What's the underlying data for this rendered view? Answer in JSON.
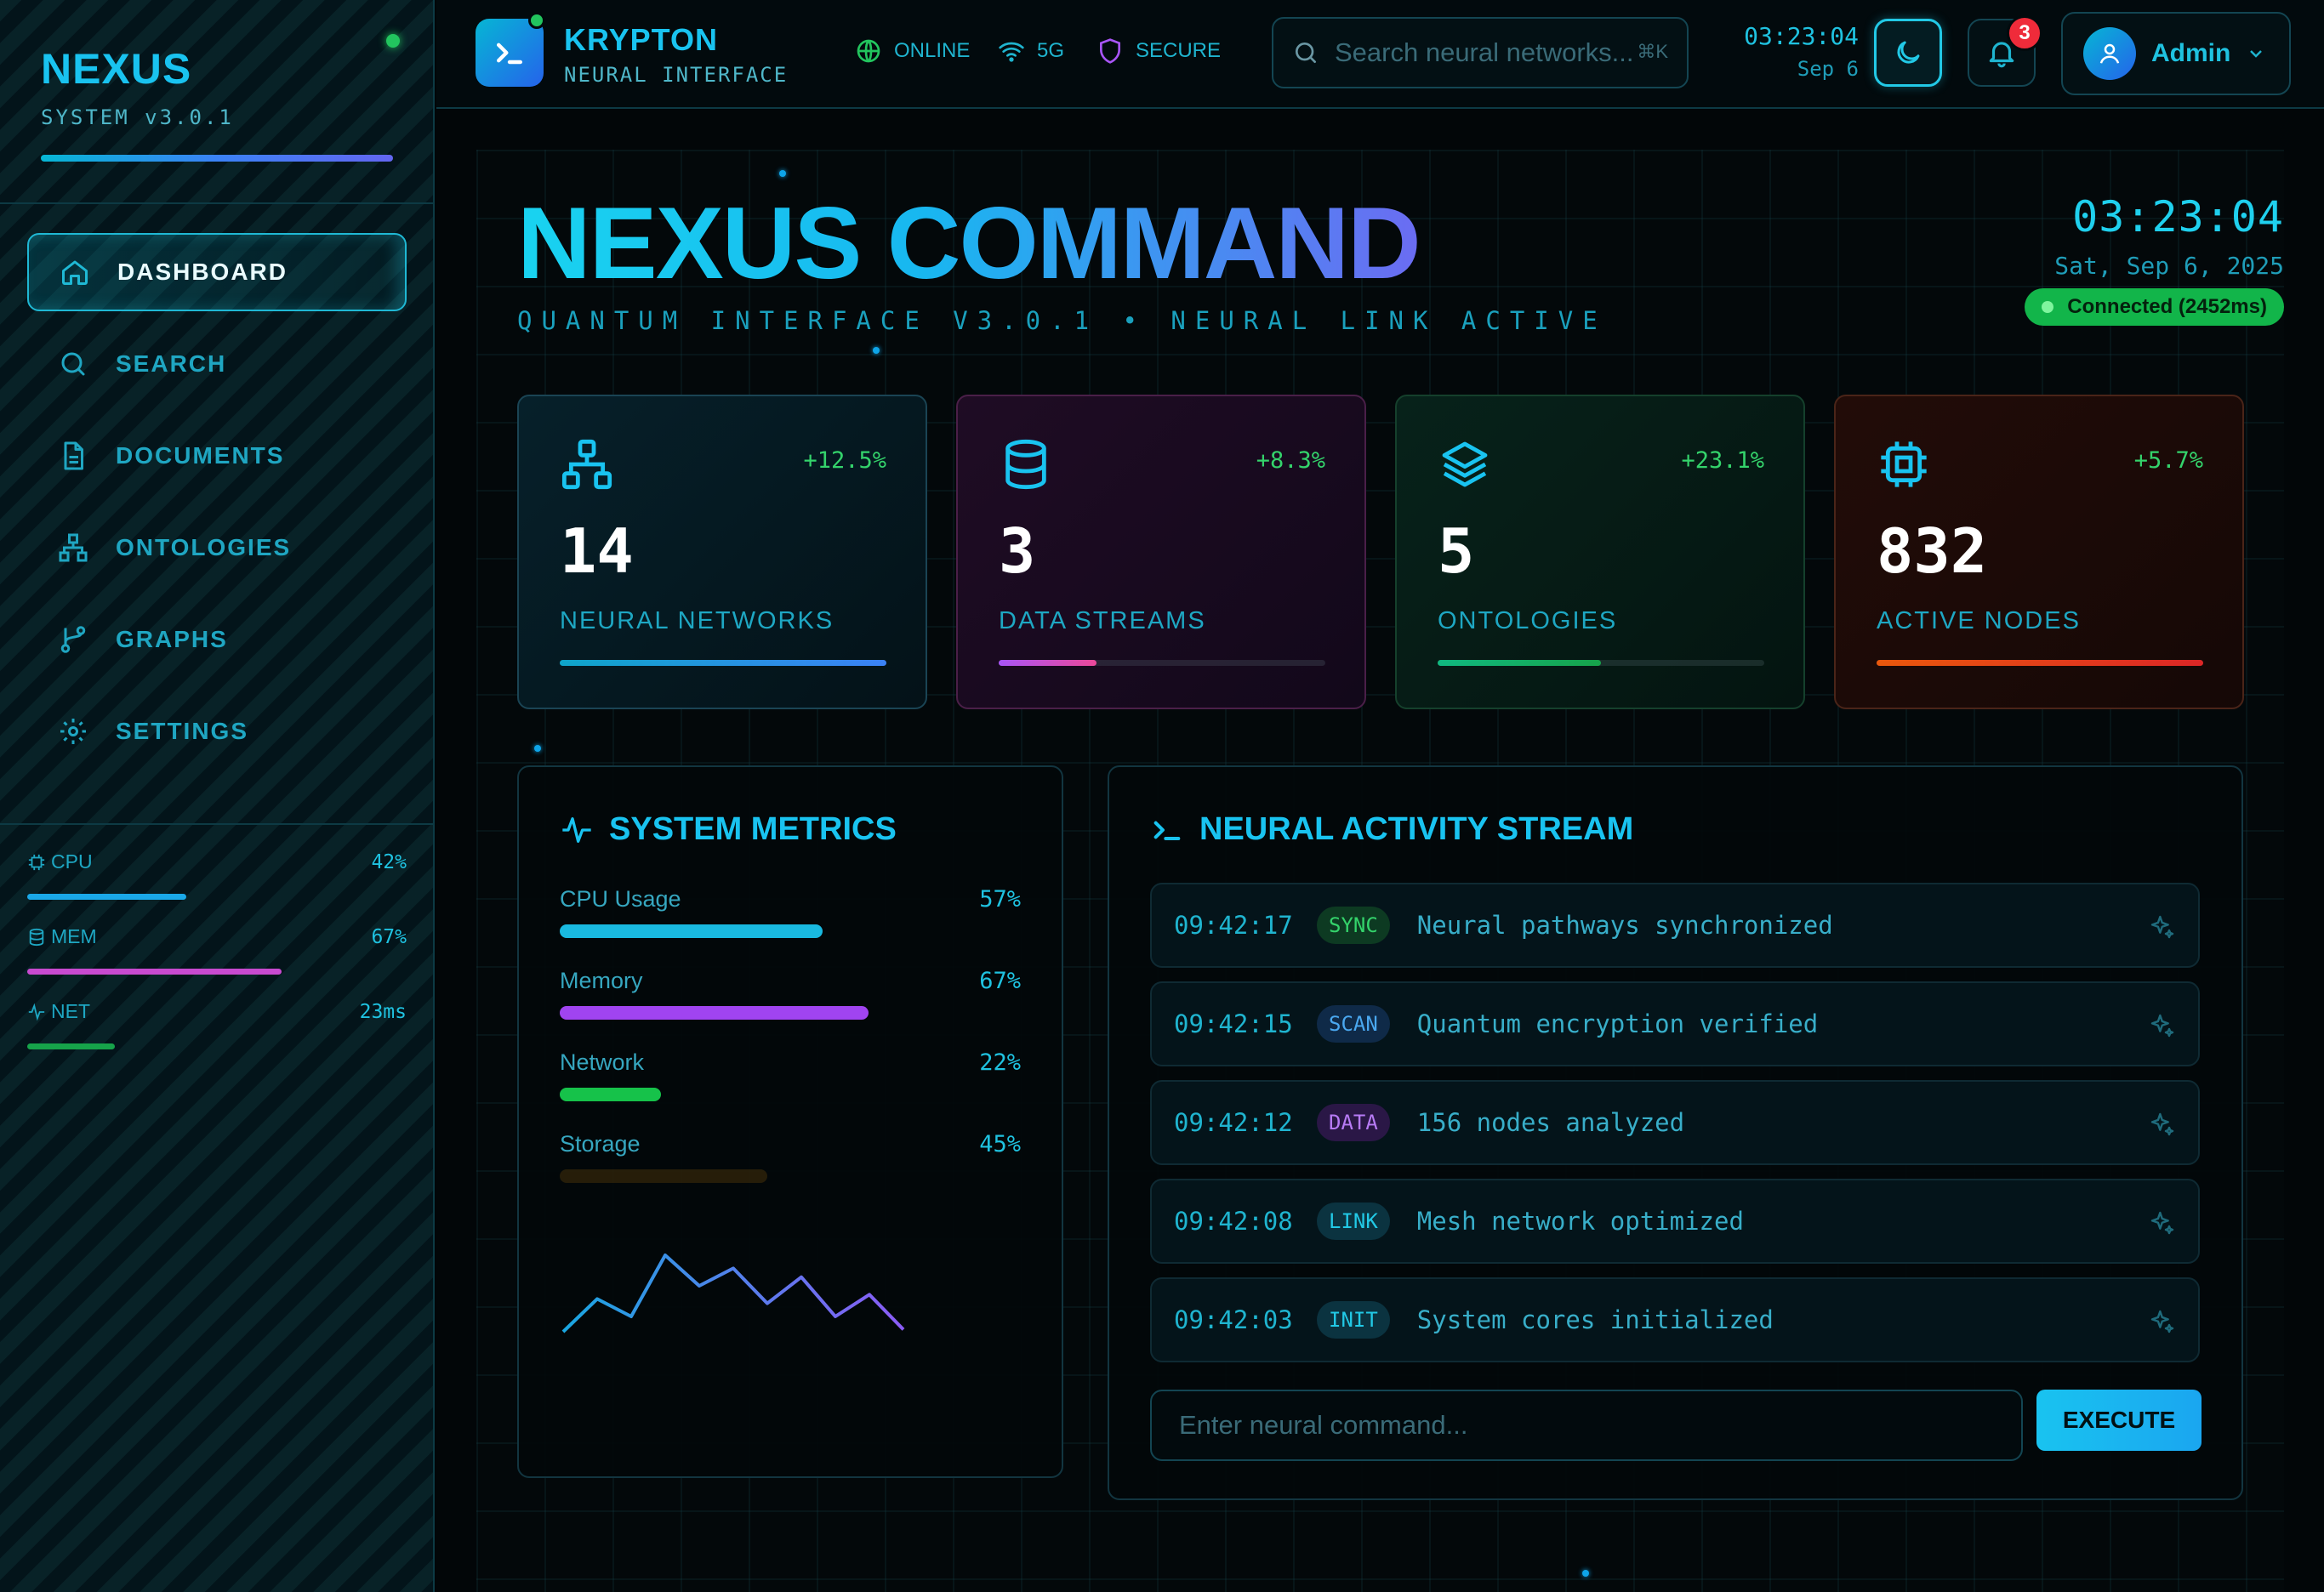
{
  "sidebar": {
    "brand": "NEXUS",
    "version": "SYSTEM v3.0.1",
    "nav": [
      {
        "label": "DASHBOARD",
        "icon": "home-icon"
      },
      {
        "label": "SEARCH",
        "icon": "search-icon"
      },
      {
        "label": "DOCUMENTS",
        "icon": "document-icon"
      },
      {
        "label": "ONTOLOGIES",
        "icon": "hierarchy-icon"
      },
      {
        "label": "GRAPHS",
        "icon": "branch-icon"
      },
      {
        "label": "SETTINGS",
        "icon": "gear-icon"
      }
    ],
    "stats": [
      {
        "label": "CPU",
        "value": "42%",
        "level": 0.42,
        "color": "#1aa8e8",
        "icon": "chip-icon"
      },
      {
        "label": "MEM",
        "value": "67%",
        "level": 0.67,
        "color": "#c84ad0",
        "icon": "database-icon"
      },
      {
        "label": "NET",
        "value": "23ms",
        "level": 0.23,
        "color": "#16a34a",
        "icon": "pulse-icon"
      }
    ]
  },
  "header": {
    "app_name": "KRYPTON",
    "app_sub": "NEURAL INTERFACE",
    "status_online": "ONLINE",
    "status_network": "5G",
    "status_secure": "SECURE",
    "search_placeholder": "Search neural networks...",
    "search_shortcut": "⌘K",
    "time": "03:23:04",
    "date": "Sep 6",
    "notifications": "3",
    "user": "Admin"
  },
  "hero": {
    "title": "NEXUS COMMAND",
    "subtitle": "QUANTUM INTERFACE V3.0.1 • NEURAL LINK ACTIVE",
    "clock": "03:23:04",
    "date": "Sat, Sep 6, 2025",
    "connection": "Connected (2452ms)"
  },
  "cards": [
    {
      "value": "14",
      "label": "NEURAL NETWORKS",
      "change": "+12.5%",
      "level": 1.0,
      "icon": "network-icon",
      "accent": "#19c3f0",
      "fill": "linear-gradient(90deg,#0ea5c9,#3b82f6)"
    },
    {
      "value": "3",
      "label": "DATA STREAMS",
      "change": "+8.3%",
      "level": 0.3,
      "icon": "database-icon",
      "accent": "#19c3f0",
      "fill": "linear-gradient(90deg,#a855f7,#ec4899)"
    },
    {
      "value": "5",
      "label": "ONTOLOGIES",
      "change": "+23.1%",
      "level": 0.5,
      "icon": "layers-icon",
      "accent": "#19c3f0",
      "fill": "linear-gradient(90deg,#10b981,#16a34a)"
    },
    {
      "value": "832",
      "label": "ACTIVE NODES",
      "change": "+5.7%",
      "level": 1.0,
      "icon": "chip-icon",
      "accent": "#19c3f0",
      "fill": "linear-gradient(90deg,#ea580c,#dc2626)"
    }
  ],
  "metrics": {
    "title": "SYSTEM METRICS",
    "items": [
      {
        "label": "CPU Usage",
        "value": "57%",
        "level": 0.57,
        "color": "#19b9e0"
      },
      {
        "label": "Memory",
        "value": "67%",
        "level": 0.67,
        "color": "#a044f0"
      },
      {
        "label": "Network",
        "value": "22%",
        "level": 0.22,
        "color": "#16c24a"
      },
      {
        "label": "Storage",
        "value": "45%",
        "level": 0.45,
        "color": "#f59e0b"
      }
    ],
    "sparkline": [
      3,
      18,
      10,
      38,
      24,
      32,
      16,
      28,
      10,
      20,
      4
    ]
  },
  "activity": {
    "title": "NEURAL ACTIVITY STREAM",
    "logs": [
      {
        "time": "09:42:17",
        "tag": "SYNC",
        "msg": "Neural pathways synchronized",
        "tag_bg": "#0d3a22",
        "tag_fg": "#34d36b"
      },
      {
        "time": "09:42:15",
        "tag": "SCAN",
        "msg": "Quantum encryption verified",
        "tag_bg": "#0f2a48",
        "tag_fg": "#4aa8f0"
      },
      {
        "time": "09:42:12",
        "tag": "DATA",
        "msg": "156 nodes analyzed",
        "tag_bg": "#2a1746",
        "tag_fg": "#b77bf5"
      },
      {
        "time": "09:42:08",
        "tag": "LINK",
        "msg": "Mesh network optimized",
        "tag_bg": "#0b3340",
        "tag_fg": "#22c9e6"
      },
      {
        "time": "09:42:03",
        "tag": "INIT",
        "msg": "System cores initialized",
        "tag_bg": "#0b3340",
        "tag_fg": "#22c9e6"
      }
    ],
    "command_placeholder": "Enter neural command...",
    "execute_label": "EXECUTE"
  }
}
